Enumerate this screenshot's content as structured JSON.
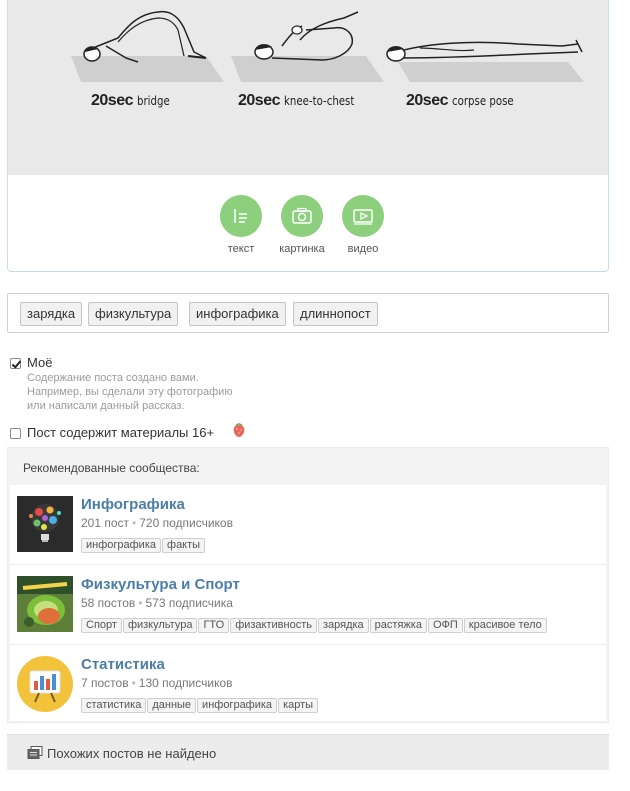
{
  "exercise_image": {
    "poses": [
      {
        "duration": "20sec",
        "name": "bridge"
      },
      {
        "duration": "20sec",
        "name": "knee-to-chest"
      },
      {
        "duration": "20sec",
        "name": "corpse pose"
      }
    ]
  },
  "media_buttons": [
    {
      "label": "текст",
      "icon": "text-icon"
    },
    {
      "label": "картинка",
      "icon": "camera-icon"
    },
    {
      "label": "видео",
      "icon": "video-icon"
    }
  ],
  "tags": [
    "зарядка",
    "физкультура",
    "инфографика",
    "длиннопост"
  ],
  "mine_option": {
    "label": "Моё",
    "checked": true,
    "hint": [
      "Содержание поста создано вами.",
      "Например, вы сделали эту фотографию",
      "или написали данный рассказ."
    ]
  },
  "adult_option": {
    "label": "Пост содержит материалы 16+",
    "checked": false,
    "icon": "strawberry-icon"
  },
  "recommended": {
    "title": "Рекомендованные сообщества:",
    "communities": [
      {
        "name": "Инфографика",
        "posts": "201 пост",
        "subscribers": "720 подписчиков",
        "tags": [
          "инфографика",
          "факты"
        ]
      },
      {
        "name": "Физкультура и Спорт",
        "posts": "58 постов",
        "subscribers": "573 подписчика",
        "tags": [
          "Спорт",
          "физкультура",
          "ГТО",
          "физактивность",
          "зарядка",
          "растяжка",
          "ОФП",
          "красивое тело"
        ]
      },
      {
        "name": "Статистика",
        "posts": "7 постов",
        "subscribers": "130 подписчиков",
        "tags": [
          "статистика",
          "данные",
          "инфографика",
          "карты"
        ]
      }
    ]
  },
  "no_similar": {
    "text": "Похожих постов не найдено",
    "icon": "posts-icon"
  },
  "colors": {
    "accent_green": "#8ccf7c",
    "community_link": "#4a7ea8"
  }
}
